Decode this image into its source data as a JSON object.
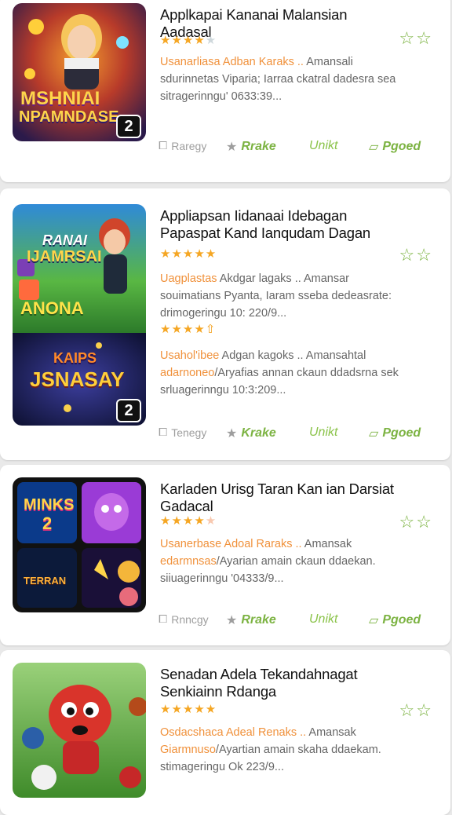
{
  "cards": [
    {
      "title": "Applkapai Kananai Malansian Aadasal",
      "thumb_text": [
        "MSHNIAI",
        "NPAMNDASE",
        "2"
      ],
      "rating": 4,
      "desc": [
        {
          "accent": "Usanarliasa Adban Karaks ..",
          "text": " Amansali"
        },
        {
          "accent": "",
          "text": "sdurinnetas Viparia; Iarraa ckatral dadesra sea"
        },
        {
          "accent": "",
          "text": "sitragerinngu' 0633:39..."
        }
      ],
      "actions": {
        "a": "Raregy",
        "b": "Rrake",
        "c": "Unikt",
        "d": "Pgoed"
      }
    },
    {
      "title": "Appliapsan Iidanaai Idebagan Papaspat Kand Ianqudam Dagan",
      "thumb_text": [
        "RANAI",
        "IJAMRSAI",
        "ANONA",
        "KAIPS",
        "JSNASAY",
        "2"
      ],
      "rating": 5,
      "rating2": 4,
      "desc": [
        {
          "accent": "Uagplastas",
          "text": " Akdgar lagaks .. Amansar"
        },
        {
          "accent": "",
          "text": "souimatians Pyanta, Iaram sseba dedeasrate:"
        },
        {
          "accent": "",
          "text": "drimogeringu 10: 220/9..."
        }
      ],
      "desc2": [
        {
          "accent": "Usahol'ibee",
          "text": " Adgan kagoks .. Amansahtal"
        },
        {
          "accent": "adarnoneo",
          "text": "/Aryafias annan ckaun ddadsrna sek"
        },
        {
          "accent": "",
          "text": "srluagerinngu 10:3:209..."
        }
      ],
      "actions": {
        "a": "Tenegy",
        "b": "Krake",
        "c": "Unikt",
        "d": "Pgoed"
      }
    },
    {
      "title": "Karladen Urisg Taran Kan ian Darsiat Gadacal",
      "thumb_text": [
        "MINKS",
        "2",
        "TERRAN"
      ],
      "rating": 4,
      "desc": [
        {
          "accent": "Usanerbase Adoal Raraks ..",
          "text": " Amansak"
        },
        {
          "accent": "edarmnsas",
          "text": "/Ayarian amain ckaun ddaekan."
        },
        {
          "accent": "",
          "text": "siiuagerinngu '04333/9..."
        }
      ],
      "actions": {
        "a": "Rnncgy",
        "b": "Rrake",
        "c": "Unikt",
        "d": "Pgoed"
      }
    },
    {
      "title": "Senadan Adela Tekandahnagat Senkiainn Rdanga",
      "thumb_text": [],
      "rating": 5,
      "desc": [
        {
          "accent": "Osdacshaca Adeal Renaks ..",
          "text": " Amansak"
        },
        {
          "accent": "Giarmnuso",
          "text": "/Ayartian amain skaha ddaekam."
        },
        {
          "accent": "",
          "text": "stimageringu Ok 223/9..."
        }
      ],
      "actions": {
        "a": "",
        "b": "",
        "c": "",
        "d": ""
      }
    }
  ],
  "colors": {
    "accent": "#f0913b",
    "green": "#7cb342",
    "star": "#f5a623"
  }
}
